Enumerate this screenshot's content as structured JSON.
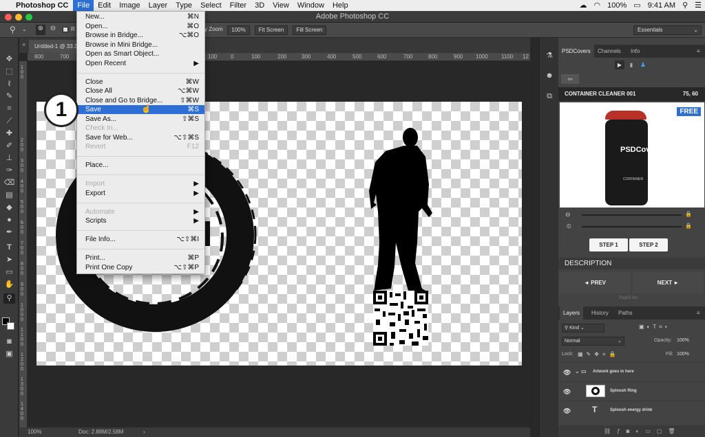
{
  "menubar": {
    "app_name": "Photoshop CC",
    "items": [
      "File",
      "Edit",
      "Image",
      "Layer",
      "Type",
      "Select",
      "Filter",
      "3D",
      "View",
      "Window",
      "Help"
    ],
    "status": {
      "battery": "100%",
      "time": "9:41 AM"
    }
  },
  "window": {
    "title": "Adobe Photoshop CC"
  },
  "options_bar": {
    "scrubby_zoom": "y Zoom",
    "resize_partial": "R",
    "zoom_percent": "100%",
    "fit_screen": "Fit Screen",
    "fill_screen": "Fill Screen",
    "workspace": "Essentials"
  },
  "document": {
    "tab_title": "Untitled-1 @ 33.3",
    "zoom": "100%",
    "doc_size": "Doc: 2.88M/2.58M",
    "ruler_h": [
      "800",
      "700",
      "100",
      "0",
      "100",
      "200",
      "300",
      "400",
      "500",
      "600",
      "700",
      "800",
      "900",
      "1000",
      "1100",
      "12"
    ],
    "ruler_v": [
      "1 0 0",
      "1 0 0",
      "2 0 0",
      "3 0 0",
      "4 0 0",
      "5 0 0",
      "6 0 0",
      "7 0 0",
      "8 0 0",
      "9 0 0",
      "1 0 0 0",
      "1 1 0 0",
      "1 2 0 0",
      "1 3 0 0",
      "1 4 0 0",
      "1 5 0 0",
      "1 6 0 0",
      "1 7 0 0"
    ]
  },
  "file_menu": {
    "items": [
      {
        "label": "New...",
        "shortcut": "⌘N",
        "enabled": true
      },
      {
        "label": "Open...",
        "shortcut": "⌘O",
        "enabled": true
      },
      {
        "label": "Browse in Bridge...",
        "shortcut": "⌥⌘O",
        "enabled": true
      },
      {
        "label": "Browse in Mini Bridge...",
        "shortcut": "",
        "enabled": true
      },
      {
        "label": "Open as Smart Object...",
        "shortcut": "",
        "enabled": true
      },
      {
        "label": "Open Recent",
        "shortcut": "▶",
        "enabled": true
      },
      {
        "label": "Close",
        "shortcut": "⌘W",
        "enabled": true
      },
      {
        "label": "Close All",
        "shortcut": "⌥⌘W",
        "enabled": true
      },
      {
        "label": "Close and Go to Bridge...",
        "shortcut": "⇧⌘W",
        "enabled": true
      },
      {
        "label": "Save",
        "shortcut": "⌘S",
        "enabled": true,
        "highlighted": true
      },
      {
        "label": "Save As...",
        "shortcut": "⇧⌘S",
        "enabled": true
      },
      {
        "label": "Check In...",
        "shortcut": "",
        "enabled": false
      },
      {
        "label": "Save for Web...",
        "shortcut": "⌥⇧⌘S",
        "enabled": true
      },
      {
        "label": "Revert",
        "shortcut": "F12",
        "enabled": false
      },
      {
        "label": "Place...",
        "shortcut": "",
        "enabled": true
      },
      {
        "label": "Import",
        "shortcut": "▶",
        "enabled": false
      },
      {
        "label": "Export",
        "shortcut": "▶",
        "enabled": true
      },
      {
        "label": "Automate",
        "shortcut": "▶",
        "enabled": false
      },
      {
        "label": "Scripts",
        "shortcut": "▶",
        "enabled": true
      },
      {
        "label": "File Info...",
        "shortcut": "⌥⇧⌘I",
        "enabled": true
      },
      {
        "label": "Print...",
        "shortcut": "⌘P",
        "enabled": true
      },
      {
        "label": "Print One Copy",
        "shortcut": "⌥⇧⌘P",
        "enabled": true
      }
    ]
  },
  "step_badge": "1",
  "psdcovers_panel": {
    "tabs": [
      "PSDCovers",
      "Channels",
      "Info"
    ],
    "product_name": "CONTAINER CLEANER 001",
    "product_code": "75, 60",
    "free_badge": "FREE",
    "bottle_brand": "PSDCov",
    "bottle_label": "CONTAINER",
    "step1": "STEP 1",
    "step2": "STEP 2",
    "description_heading": "DESCRIPTION",
    "prev": "◄ PREV",
    "next": "NEXT ►",
    "footer": "PsplUI Inc."
  },
  "layers_panel": {
    "tabs": [
      "Layers",
      "History",
      "Paths"
    ],
    "filter": "Kind",
    "blend_mode": "Normal",
    "opacity_label": "Opacity:",
    "opacity": "100%",
    "lock_label": "Lock:",
    "fill_label": "Fill:",
    "fill": "100%",
    "layers": [
      {
        "name": "Artwork goes in here",
        "kind": "group"
      },
      {
        "name": "Sploosh Ring",
        "kind": "pixel"
      },
      {
        "name": "Sploosh energy drink",
        "kind": "type"
      }
    ]
  },
  "colors": {
    "accent": "#2e6fd6",
    "panel": "#434343",
    "menu": "#ececec"
  }
}
